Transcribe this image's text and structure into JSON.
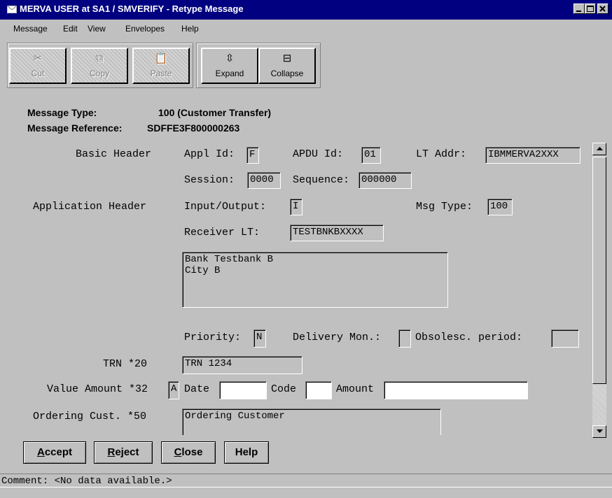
{
  "window": {
    "title": "MERVA USER at SA1 / SMVERIFY - Retype Message"
  },
  "menu": [
    "Message",
    "Edit",
    "View",
    "Envelopes",
    "Help"
  ],
  "toolbar": {
    "cut_label": "Cut",
    "copy_label": "Copy",
    "paste_label": "Paste",
    "expand_label": "Expand",
    "collapse_label": "Collapse"
  },
  "info": {
    "type_label": "Message Type:",
    "type_value": "100  (Customer Transfer)",
    "ref_label": "Message Reference:",
    "ref_value": "SDFFE3F800000263"
  },
  "basic_header": {
    "section_label": "Basic Header",
    "appl_id_label": "Appl Id:",
    "appl_id_value": "F",
    "apdu_id_label": "APDU Id:",
    "apdu_id_value": "01",
    "lt_addr_label": "LT Addr:",
    "lt_addr_value": "IBMMERVA2XXX",
    "session_label": "Session:",
    "session_value": "0000",
    "sequence_label": "Sequence:",
    "sequence_value": "000000"
  },
  "application_header": {
    "section_label": "Application Header",
    "io_label": "Input/Output:",
    "io_value": "I",
    "msg_type_label": "Msg Type:",
    "msg_type_value": "100",
    "receiver_label": "Receiver LT:",
    "receiver_value": "TESTBNKBXXXX",
    "address_text": "Bank Testbank B\nCity B",
    "priority_label": "Priority:",
    "priority_value": "N",
    "delivery_label": "Delivery Mon.:",
    "delivery_value": "",
    "obsolescence_label": "Obsolesc. period:",
    "obsolescence_value": ""
  },
  "fields": {
    "trn_label": "TRN *20",
    "trn_value": "TRN 1234",
    "value_amount_label": "Value Amount *32",
    "option_value": "A",
    "date_label": "Date",
    "date_value": "",
    "code_label": "Code",
    "code_value": "",
    "amount_label": "Amount",
    "amount_value": "",
    "ordering_label": "Ordering Cust. *50",
    "ordering_value": "Ordering Customer"
  },
  "buttons": {
    "accept": {
      "first": "A",
      "rest": "ccept"
    },
    "reject": {
      "first": "R",
      "rest": "eject"
    },
    "close": {
      "first": "C",
      "rest": "lose"
    },
    "help": {
      "first": "",
      "rest": "Help"
    }
  },
  "status": {
    "comment": "Comment: <No data available.>"
  }
}
